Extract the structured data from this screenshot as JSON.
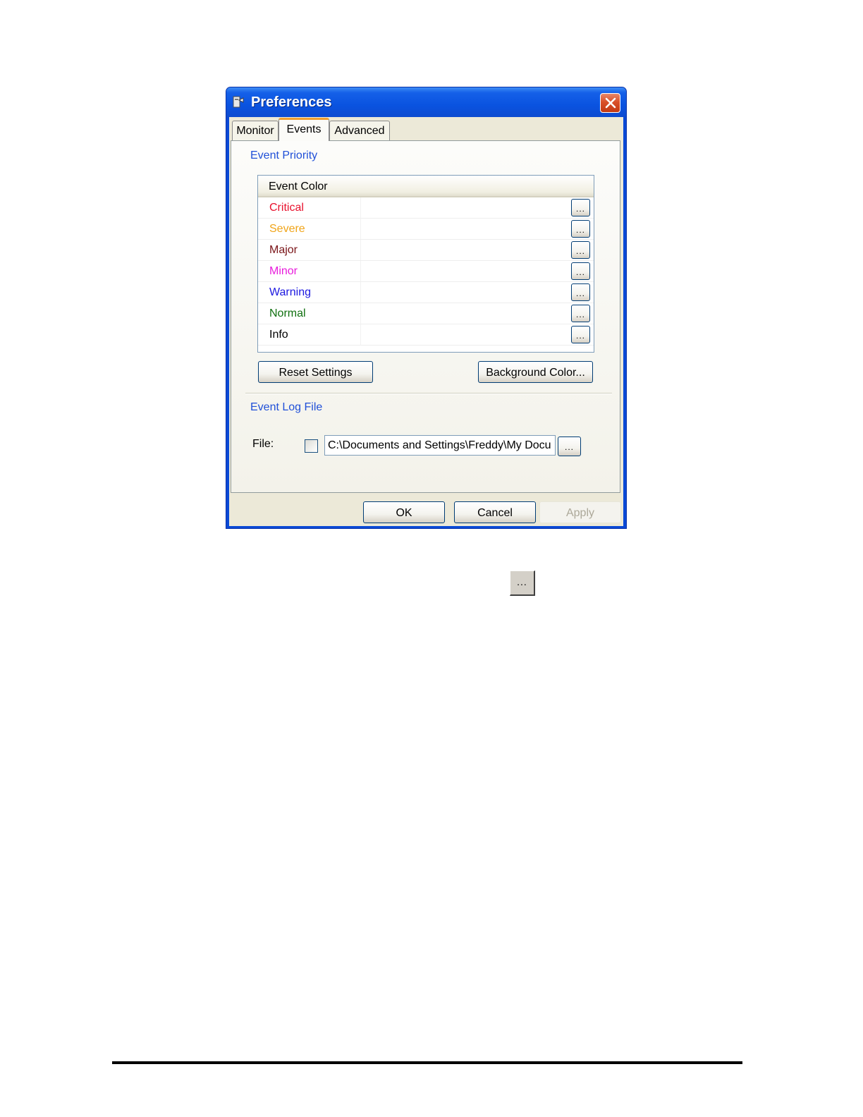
{
  "window": {
    "title": "Preferences",
    "icon": "preferences-app-icon",
    "close_icon": "close-icon"
  },
  "tabs": [
    {
      "label": "Monitor",
      "selected": false
    },
    {
      "label": "Events",
      "selected": true
    },
    {
      "label": "Advanced",
      "selected": false
    }
  ],
  "event_priority": {
    "section_label": "Event Priority",
    "column_header": "Event Color",
    "events": [
      {
        "name": "Critical",
        "color": "#e8102c",
        "button_label": "..."
      },
      {
        "name": "Severe",
        "color": "#f0a418",
        "button_label": "..."
      },
      {
        "name": "Major",
        "color": "#7a1418",
        "button_label": "..."
      },
      {
        "name": "Minor",
        "color": "#e81cdc",
        "button_label": "..."
      },
      {
        "name": "Warning",
        "color": "#1c18e0",
        "button_label": "..."
      },
      {
        "name": "Normal",
        "color": "#107010",
        "button_label": "..."
      },
      {
        "name": "Info",
        "color": "#000000",
        "button_label": "..."
      }
    ],
    "reset_button_label": "Reset Settings",
    "background_button_label": "Background Color..."
  },
  "event_log": {
    "section_label": "Event Log File",
    "file_label": "File:",
    "enabled": false,
    "path_value": "C:\\Documents and Settings\\Freddy\\My Docu",
    "browse_button_label": "..."
  },
  "dialog_buttons": {
    "ok_label": "OK",
    "cancel_label": "Cancel",
    "apply_label": "Apply"
  },
  "standalone_button_label": "...",
  "colors": {
    "titlebar": "#0a53e0",
    "section_label": "#2050d8",
    "dialog_face": "#ece9d8",
    "active_tab_accent": "#f0a030",
    "disabled_text": "#aca899"
  }
}
